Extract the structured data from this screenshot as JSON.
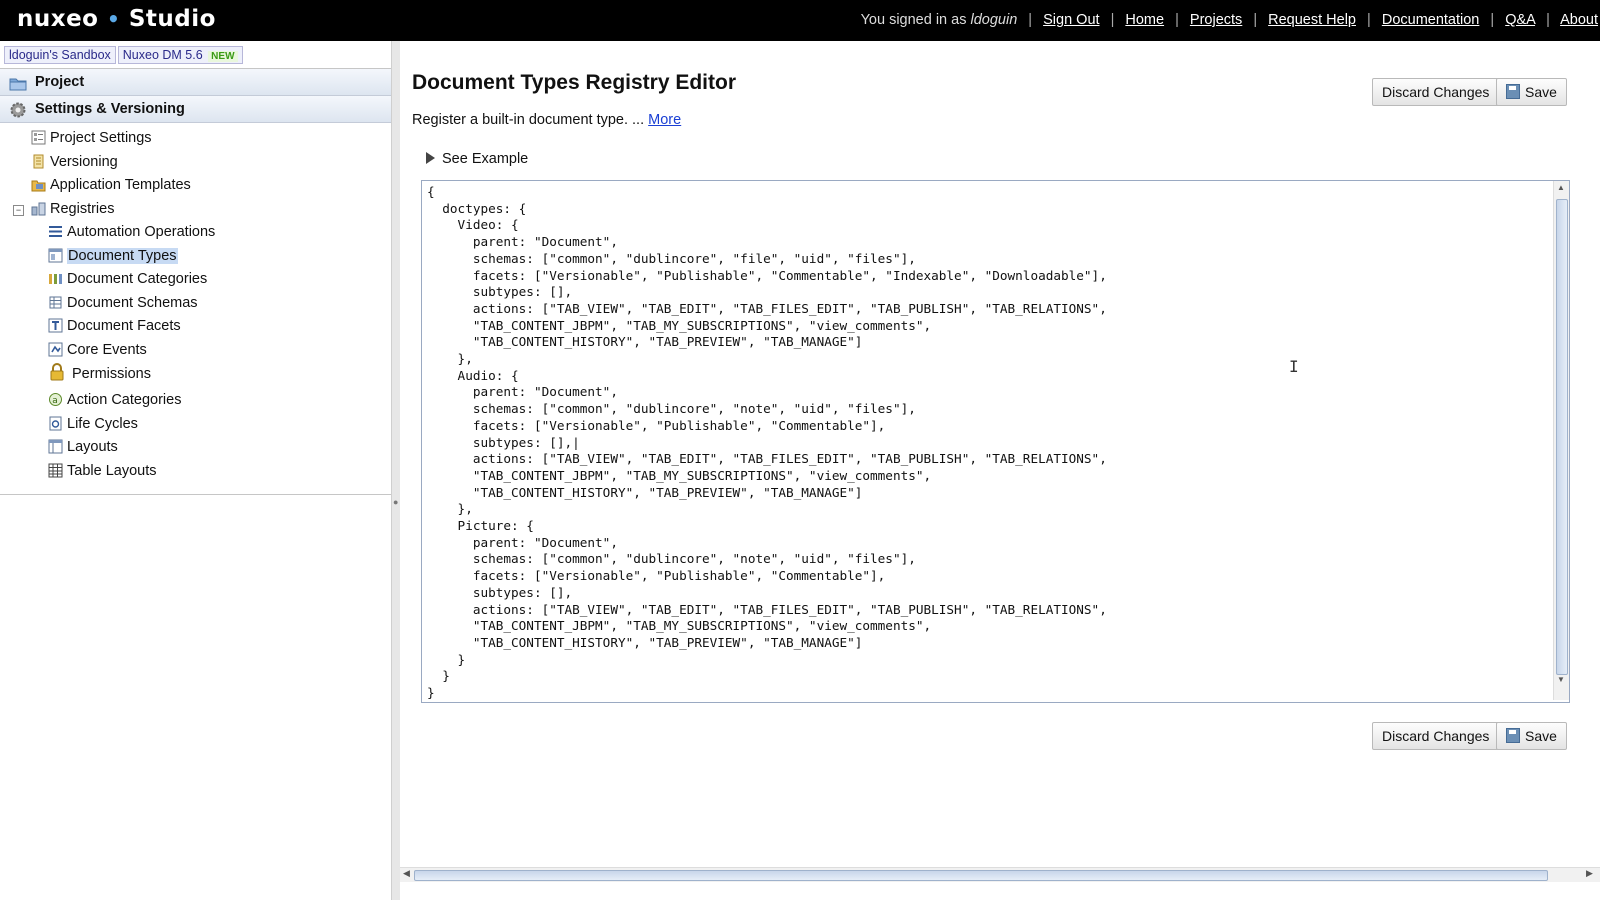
{
  "brand": {
    "name_left": "nuxeo",
    "dot": "•",
    "name_right": "Studio"
  },
  "topnav": {
    "signed_in_prefix": "You signed in as",
    "username": "ldoguin",
    "links": [
      "Sign Out",
      "Home",
      "Projects",
      "Request Help",
      "Documentation",
      "Q&A",
      "About"
    ],
    "separator": "|"
  },
  "chips": {
    "sandbox": "ldoguin's Sandbox",
    "target": "Nuxeo DM 5.6",
    "badge": "NEW"
  },
  "sidebar": {
    "sections": [
      "Project",
      "Settings & Versioning"
    ],
    "items": [
      {
        "label": "Project Settings",
        "icon": "project-settings-icon"
      },
      {
        "label": "Versioning",
        "icon": "versioning-icon"
      },
      {
        "label": "Application Templates",
        "icon": "application-templates-icon"
      },
      {
        "label": "Registries",
        "icon": "registries-icon"
      },
      {
        "label": "Automation Operations",
        "icon": "automation-operations-icon"
      },
      {
        "label": "Document Types",
        "icon": "document-types-icon",
        "selected": true
      },
      {
        "label": "Document Categories",
        "icon": "document-categories-icon"
      },
      {
        "label": "Document Schemas",
        "icon": "document-schemas-icon"
      },
      {
        "label": "Document Facets",
        "icon": "document-facets-icon"
      },
      {
        "label": "Core Events",
        "icon": "core-events-icon"
      },
      {
        "label": "Permissions",
        "icon": "permissions-icon"
      },
      {
        "label": "Action Categories",
        "icon": "action-categories-icon"
      },
      {
        "label": "Life Cycles",
        "icon": "life-cycles-icon"
      },
      {
        "label": "Layouts",
        "icon": "layouts-icon"
      },
      {
        "label": "Table Layouts",
        "icon": "table-layouts-icon"
      }
    ],
    "collapse_symbol": "−"
  },
  "main": {
    "title": "Document Types Registry Editor",
    "description": "Register a built-in document type. ...",
    "more_link": "More",
    "see_example": "See Example",
    "discard_label": "Discard Changes",
    "save_label": "Save",
    "code": "{\n  doctypes: {\n    Video: {\n      parent: \"Document\",\n      schemas: [\"common\", \"dublincore\", \"file\", \"uid\", \"files\"],\n      facets: [\"Versionable\", \"Publishable\", \"Commentable\", \"Indexable\", \"Downloadable\"],\n      subtypes: [],\n      actions: [\"TAB_VIEW\", \"TAB_EDIT\", \"TAB_FILES_EDIT\", \"TAB_PUBLISH\", \"TAB_RELATIONS\",\n      \"TAB_CONTENT_JBPM\", \"TAB_MY_SUBSCRIPTIONS\", \"view_comments\",\n      \"TAB_CONTENT_HISTORY\", \"TAB_PREVIEW\", \"TAB_MANAGE\"]\n    },\n    Audio: {\n      parent: \"Document\",\n      schemas: [\"common\", \"dublincore\", \"note\", \"uid\", \"files\"],\n      facets: [\"Versionable\", \"Publishable\", \"Commentable\"],\n      subtypes: [],|\n      actions: [\"TAB_VIEW\", \"TAB_EDIT\", \"TAB_FILES_EDIT\", \"TAB_PUBLISH\", \"TAB_RELATIONS\",\n      \"TAB_CONTENT_JBPM\", \"TAB_MY_SUBSCRIPTIONS\", \"view_comments\",\n      \"TAB_CONTENT_HISTORY\", \"TAB_PREVIEW\", \"TAB_MANAGE\"]\n    },\n    Picture: {\n      parent: \"Document\",\n      schemas: [\"common\", \"dublincore\", \"note\", \"uid\", \"files\"],\n      facets: [\"Versionable\", \"Publishable\", \"Commentable\"],\n      subtypes: [],\n      actions: [\"TAB_VIEW\", \"TAB_EDIT\", \"TAB_FILES_EDIT\", \"TAB_PUBLISH\", \"TAB_RELATIONS\",\n      \"TAB_CONTENT_JBPM\", \"TAB_MY_SUBSCRIPTIONS\", \"view_comments\",\n      \"TAB_CONTENT_HISTORY\", \"TAB_PREVIEW\", \"TAB_MANAGE\"]\n    }\n  }\n}"
  },
  "colors": {
    "topbar": "#000000",
    "link": "#1a3fd4",
    "selected": "#c7daf3",
    "brand_dot": "#5aa8e6"
  }
}
